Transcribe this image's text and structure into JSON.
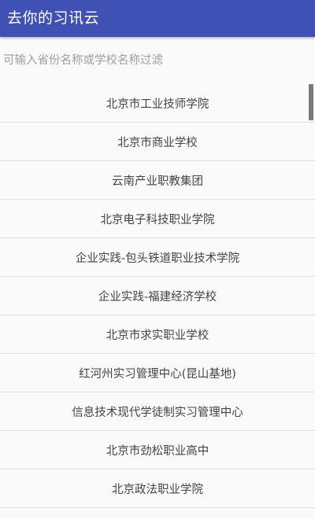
{
  "app_bar": {
    "title": "去你的习讯云"
  },
  "filter": {
    "placeholder": "可输入省份名称或学校名称过滤",
    "value": ""
  },
  "schools": [
    {
      "label": "北京市工业技师学院"
    },
    {
      "label": "北京市商业学校"
    },
    {
      "label": "云南产业职教集团"
    },
    {
      "label": "北京电子科技职业学院"
    },
    {
      "label": "企业实践-包头铁道职业技术学院"
    },
    {
      "label": "企业实践-福建经济学校"
    },
    {
      "label": "北京市求实职业学校"
    },
    {
      "label": "红河州实习管理中心(昆山基地)"
    },
    {
      "label": "信息技术现代学徒制实习管理中心"
    },
    {
      "label": "北京市劲松职业高中"
    },
    {
      "label": "北京政法职业学院"
    }
  ],
  "colors": {
    "app_bar": "#3f51b5",
    "background": "#fafafa",
    "divider": "#dedede"
  }
}
